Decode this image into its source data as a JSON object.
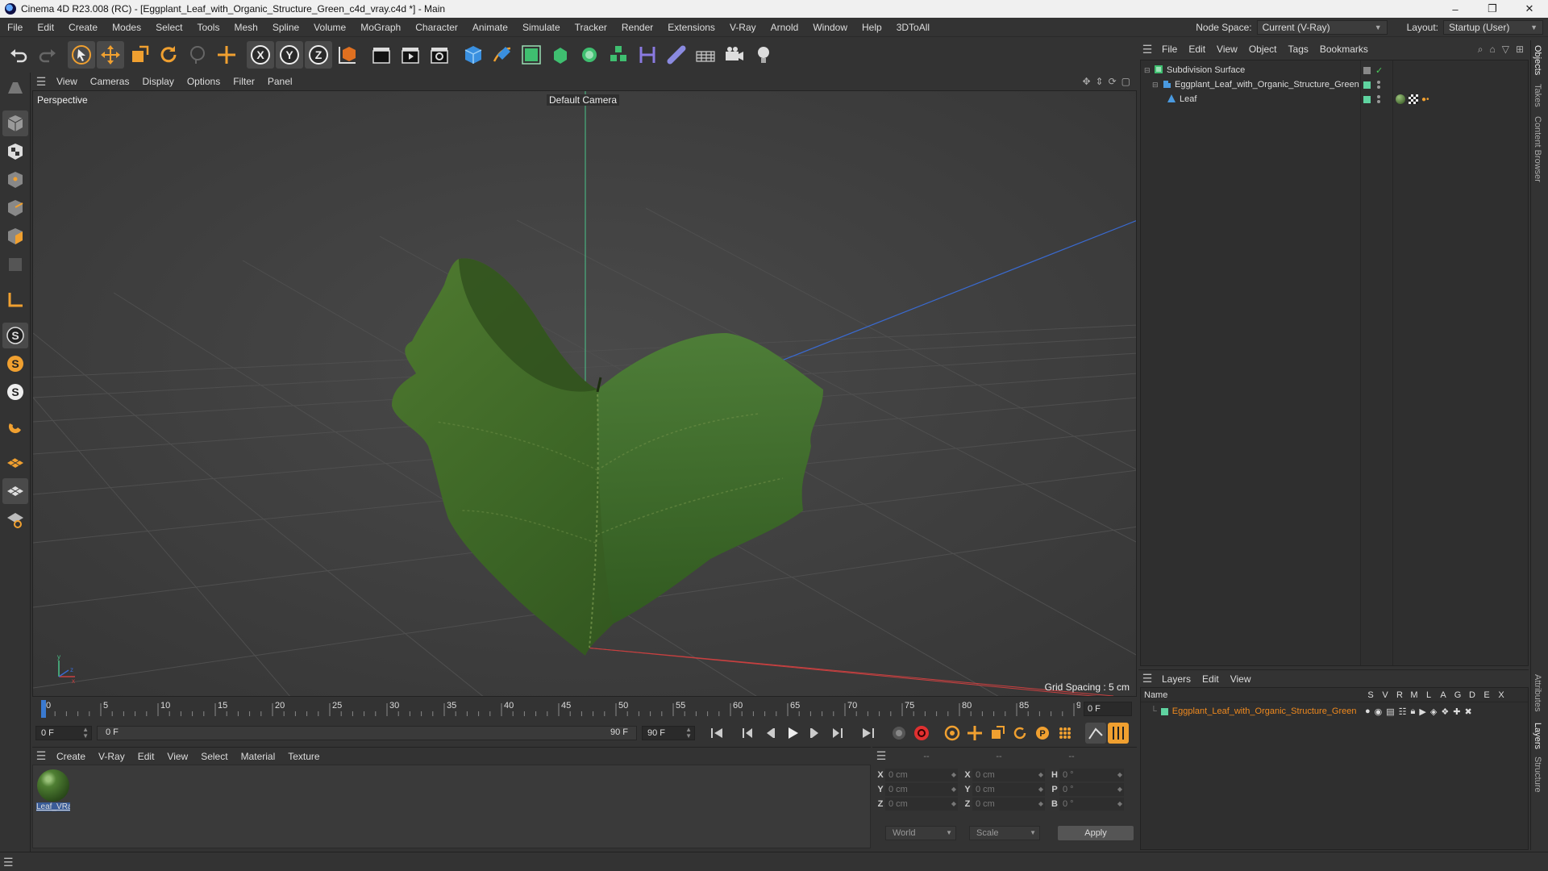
{
  "window": {
    "title": "Cinema 4D R23.008 (RC) - [Eggplant_Leaf_with_Organic_Structure_Green_c4d_vray.c4d *] - Main",
    "minimize": "–",
    "maximize": "❐",
    "close": "✕"
  },
  "menu": [
    "File",
    "Edit",
    "Create",
    "Modes",
    "Select",
    "Tools",
    "Mesh",
    "Spline",
    "Volume",
    "MoGraph",
    "Character",
    "Animate",
    "Simulate",
    "Tracker",
    "Render",
    "Extensions",
    "V-Ray",
    "Arnold",
    "Window",
    "Help",
    "3DToAll"
  ],
  "node_space": {
    "label": "Node Space:",
    "value": "Current (V-Ray)"
  },
  "layout": {
    "label": "Layout:",
    "value": "Startup (User)"
  },
  "viewport": {
    "menu": [
      "View",
      "Cameras",
      "Display",
      "Options",
      "Filter",
      "Panel"
    ],
    "label": "Perspective",
    "camera": "Default Camera",
    "grid_spacing": "Grid Spacing : 5 cm"
  },
  "timeline": {
    "ticks": [
      "0",
      "5",
      "10",
      "15",
      "20",
      "25",
      "30",
      "35",
      "40",
      "45",
      "50",
      "55",
      "60",
      "65",
      "70",
      "75",
      "80",
      "85",
      "90"
    ],
    "current_frame": "0 F"
  },
  "playback": {
    "start": "0 F",
    "range_start": "0 F",
    "range_end": "90 F",
    "end": "90 F"
  },
  "material_manager": {
    "menu": [
      "Create",
      "V-Ray",
      "Edit",
      "View",
      "Select",
      "Material",
      "Texture"
    ],
    "materials": [
      {
        "name": "Leaf_VRay"
      }
    ]
  },
  "coordinates": {
    "headers": [
      "--",
      "--",
      "--"
    ],
    "rows": [
      {
        "pos_axis": "X",
        "pos": "0 cm",
        "size_axis": "X",
        "size": "0 cm",
        "rot_axis": "H",
        "rot": "0 °"
      },
      {
        "pos_axis": "Y",
        "pos": "0 cm",
        "size_axis": "Y",
        "size": "0 cm",
        "rot_axis": "P",
        "rot": "0 °"
      },
      {
        "pos_axis": "Z",
        "pos": "0 cm",
        "size_axis": "Z",
        "size": "0 cm",
        "rot_axis": "B",
        "rot": "0 °"
      }
    ],
    "space": "World",
    "mode": "Scale",
    "apply": "Apply"
  },
  "object_manager": {
    "menu": [
      "File",
      "Edit",
      "View",
      "Object",
      "Tags",
      "Bookmarks"
    ],
    "objects": [
      {
        "name": "Subdivision Surface"
      },
      {
        "name": "Eggplant_Leaf_with_Organic_Structure_Green"
      },
      {
        "name": "Leaf"
      }
    ]
  },
  "layers": {
    "menu": [
      "Layers",
      "Edit",
      "View"
    ],
    "name_header": "Name",
    "columns": [
      "S",
      "V",
      "R",
      "M",
      "L",
      "A",
      "G",
      "D",
      "E",
      "X"
    ],
    "items": [
      {
        "name": "Eggplant_Leaf_with_Organic_Structure_Green",
        "color": "#5fd3a0"
      }
    ]
  },
  "side_tabs": [
    "Objects",
    "Takes",
    "Content Browser",
    "Attributes",
    "Layers",
    "Structure"
  ],
  "colors": {
    "accent_orange": "#f08a1e",
    "leaf_green": "#3f6a2a",
    "axis_x": "#c84040",
    "axis_y": "#4ac48a",
    "axis_z": "#3a6ad0"
  }
}
